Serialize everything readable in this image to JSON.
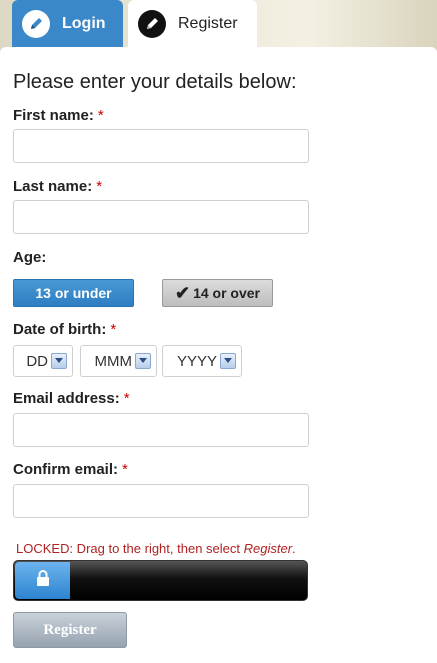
{
  "tabs": {
    "login": "Login",
    "register": "Register"
  },
  "form": {
    "heading": "Please enter your details below:",
    "required_marker": "*",
    "first_name_label": "First name:",
    "last_name_label": "Last name:",
    "age_label": "Age:",
    "age_under": "13 or under",
    "age_over": "14 or over",
    "age_selected": "14 or over",
    "dob_label": "Date of birth:",
    "dob_day": "DD",
    "dob_month": "MMM",
    "dob_year": "YYYY",
    "email_label": "Email address:",
    "confirm_email_label": "Confirm email:",
    "first_name_value": "",
    "last_name_value": "",
    "email_value": "",
    "confirm_email_value": ""
  },
  "slider": {
    "message_prefix": "LOCKED: Drag to the right, then select ",
    "message_action": "Register",
    "message_suffix": ".",
    "icon": "lock-icon"
  },
  "submit_label": "Register",
  "colors": {
    "tab_active": "#3a87c9",
    "required": "#cc0000",
    "locked_text": "#b22222",
    "age_under_button": "#2d7ec2"
  }
}
